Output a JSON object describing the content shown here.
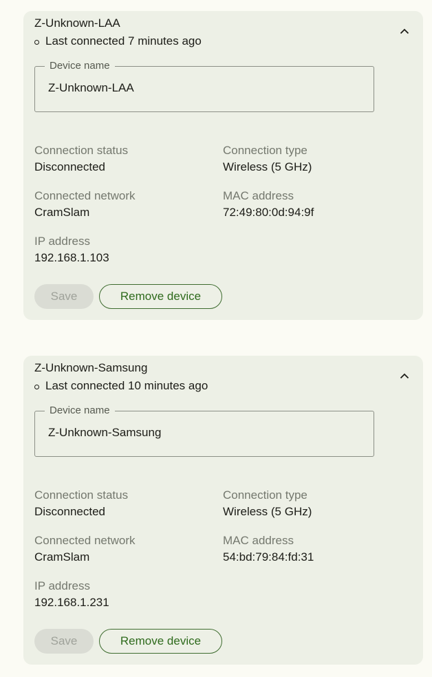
{
  "devices": [
    {
      "title": "Z-Unknown-LAA",
      "last_connected": "Last connected 7 minutes ago",
      "device_name_label": "Device name",
      "device_name_value": "Z-Unknown-LAA",
      "connection_status_label": "Connection status",
      "connection_status_value": "Disconnected",
      "connection_type_label": "Connection type",
      "connection_type_value": "Wireless (5 GHz)",
      "connected_network_label": "Connected network",
      "connected_network_value": "CramSlam",
      "mac_address_label": "MAC address",
      "mac_address_value": "72:49:80:0d:94:9f",
      "ip_address_label": "IP address",
      "ip_address_value": "192.168.1.103",
      "save_label": "Save",
      "remove_label": "Remove device",
      "expanded": true
    },
    {
      "title": "Z-Unknown-Samsung",
      "last_connected": "Last connected 10 minutes ago",
      "device_name_label": "Device name",
      "device_name_value": "Z-Unknown-Samsung",
      "connection_status_label": "Connection status",
      "connection_status_value": "Disconnected",
      "connection_type_label": "Connection type",
      "connection_type_value": "Wireless (5 GHz)",
      "connected_network_label": "Connected network",
      "connected_network_value": "CramSlam",
      "mac_address_label": "MAC address",
      "mac_address_value": "54:bd:79:84:fd:31",
      "ip_address_label": "IP address",
      "ip_address_value": "192.168.1.231",
      "save_label": "Save",
      "remove_label": "Remove device",
      "expanded": true
    }
  ],
  "icons": {
    "collapse": "chevron-up-icon",
    "status": "status-dot-icon"
  },
  "colors": {
    "page_background": "#fbfbf4",
    "card_background": "#edf0e6",
    "accent_green": "#2e6a1c",
    "disabled_button": "#dadcd4",
    "muted_label": "#74786e"
  }
}
